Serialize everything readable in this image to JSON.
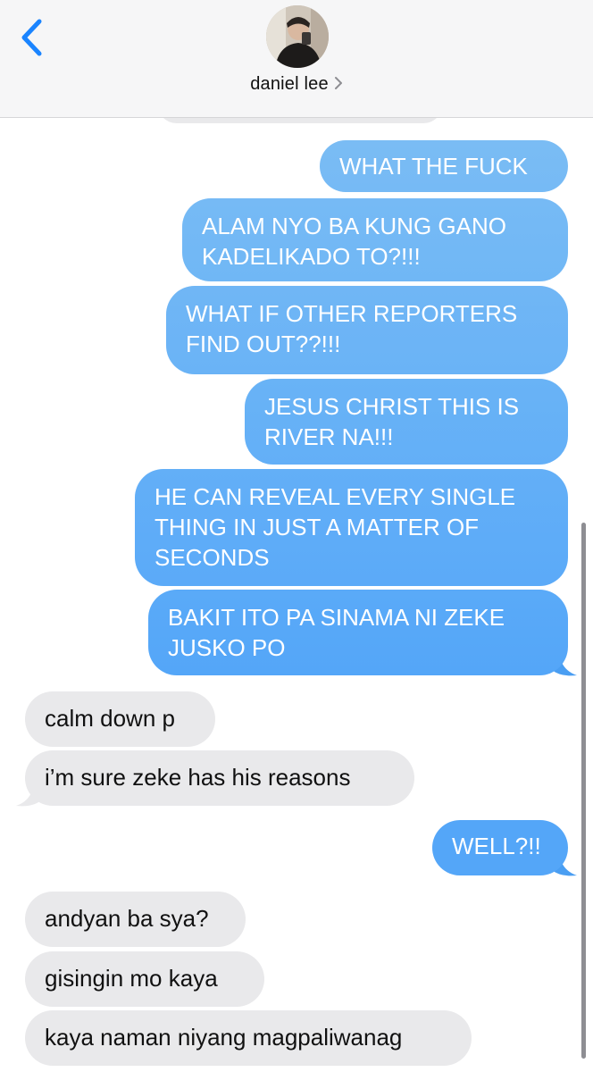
{
  "header": {
    "contact_name": "daniel lee",
    "back_icon": "chevron-left-icon",
    "chevron_icon": "chevron-right-icon",
    "colors": {
      "background": "#f6f6f7",
      "accent": "#1a84ff"
    }
  },
  "messages": [
    {
      "direction": "outgoing",
      "text": "WHAT THE FUCK"
    },
    {
      "direction": "outgoing",
      "text": "ALAM NYO BA KUNG GANO\nKADELIKADO TO?!!!"
    },
    {
      "direction": "outgoing",
      "text": "WHAT IF OTHER REPORTERS\nFIND OUT??!!!"
    },
    {
      "direction": "outgoing",
      "text": "JESUS CHRIST THIS IS\nRIVER NA!!!"
    },
    {
      "direction": "outgoing",
      "text": "HE CAN REVEAL EVERY SINGLE\nTHING IN JUST A MATTER OF\nSECONDS"
    },
    {
      "direction": "outgoing",
      "text": "BAKIT ITO PA SINAMA NI ZEKE\nJUSKO PO"
    },
    {
      "direction": "incoming",
      "text": "calm down p"
    },
    {
      "direction": "incoming",
      "text": "i’m sure zeke has his reasons"
    },
    {
      "direction": "outgoing",
      "text": "WELL?!!"
    },
    {
      "direction": "incoming",
      "text": "andyan ba sya?"
    },
    {
      "direction": "incoming",
      "text": "gisingin mo kaya"
    },
    {
      "direction": "incoming",
      "text": "kaya naman niyang magpaliwanag"
    }
  ],
  "colors": {
    "outgoing_top": "#1a84ff",
    "outgoing_bottom": "#5aa7f0",
    "incoming": "#e9e9eb"
  }
}
